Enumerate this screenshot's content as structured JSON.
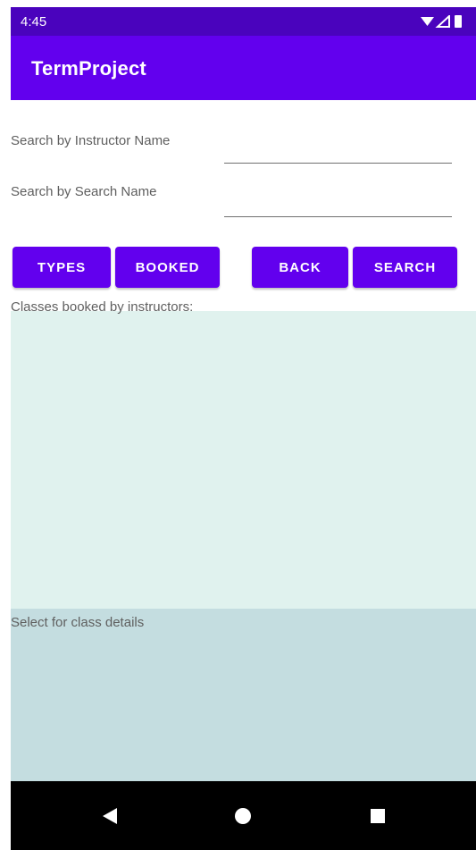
{
  "status_bar": {
    "time": "4:45",
    "icons": [
      "wifi-icon",
      "signal-icon",
      "battery-icon"
    ]
  },
  "app_bar": {
    "title": "TermProject",
    "color": "#6200ee",
    "status_color": "#4a03bd"
  },
  "form": {
    "instructor_label": "Search by Instructor Name",
    "instructor_value": "",
    "search_label": "Search by Search Name",
    "search_value": ""
  },
  "buttons": {
    "types": "TYPES",
    "booked": "BOOKED",
    "back": "BACK",
    "search": "SEARCH"
  },
  "booked_list": {
    "caption": "Classes booked by instructors:",
    "items": [],
    "background": "#e0f2ee"
  },
  "details": {
    "caption": "Select for class details",
    "background": "#c4dde0"
  },
  "nav_bar": {
    "icons": [
      "back-icon",
      "home-icon",
      "recents-icon"
    ]
  }
}
